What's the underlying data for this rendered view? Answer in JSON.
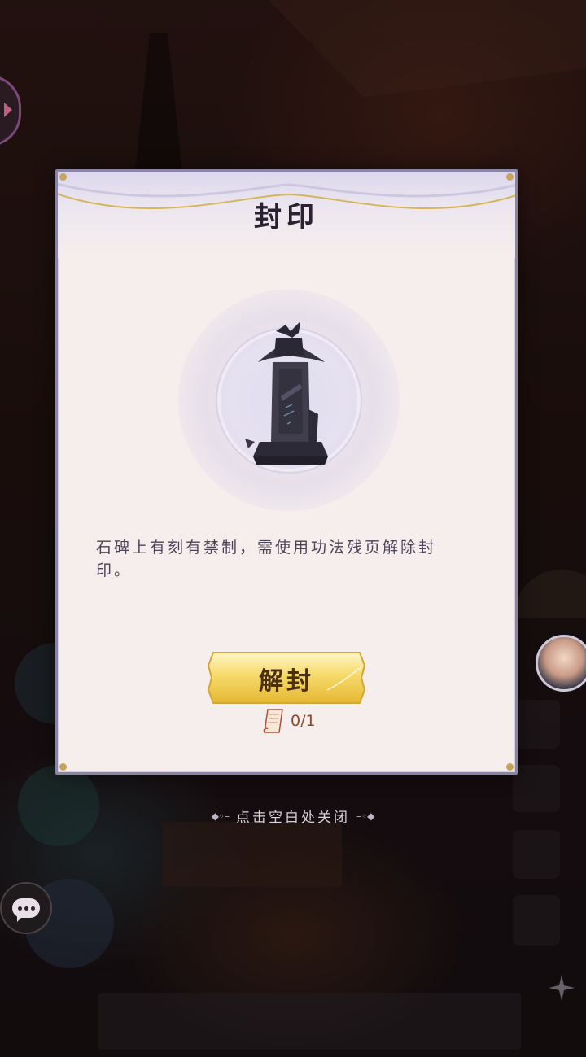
{
  "dialog": {
    "title": "封印",
    "description": "石碑上有刻有禁制，需使用功法残页解除封印。",
    "unseal_button": "解封",
    "cost_count": "0/1"
  },
  "close_hint": "点击空白处关闭",
  "icons": {
    "item": "stone-stele-icon",
    "cost": "scroll-page-icon",
    "chat": "chat-bubble-icon",
    "compass": "compass-star-icon"
  },
  "colors": {
    "accent_gold": "#f2d35a",
    "frame": "#8a84a6",
    "panel": "#f6eeec"
  }
}
